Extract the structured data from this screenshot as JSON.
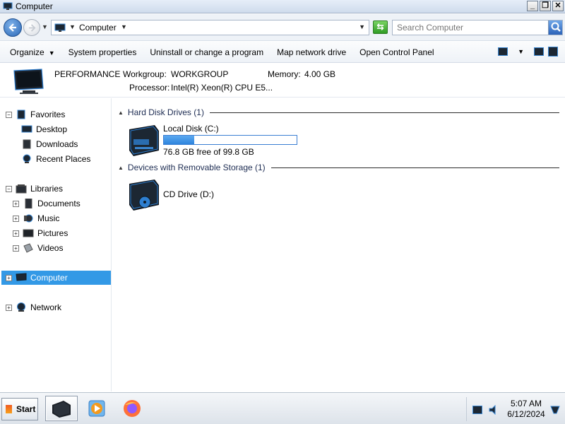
{
  "window": {
    "title": "Computer"
  },
  "window_buttons": {
    "minimize": "_",
    "maximize": "❐",
    "close": "✕"
  },
  "address": {
    "location": "Computer"
  },
  "search": {
    "placeholder": "Search Computer"
  },
  "commands": {
    "organize": "Organize",
    "system_properties": "System properties",
    "uninstall": "Uninstall or change a program",
    "map_drive": "Map network drive",
    "control_panel": "Open Control Panel"
  },
  "details": {
    "computer_name": "PERFORMANCE",
    "workgroup_label": "Workgroup:",
    "workgroup_value": "WORKGROUP",
    "memory_label": "Memory:",
    "memory_value": "4.00 GB",
    "processor_label": "Processor:",
    "processor_value": "Intel(R) Xeon(R) CPU E5..."
  },
  "nav": {
    "favorites": "Favorites",
    "desktop": "Desktop",
    "downloads": "Downloads",
    "recent_places": "Recent Places",
    "libraries": "Libraries",
    "documents": "Documents",
    "music": "Music",
    "pictures": "Pictures",
    "videos": "Videos",
    "computer": "Computer",
    "network": "Network",
    "expand_glyph": "+",
    "collapse_glyph": "−"
  },
  "groups": {
    "hdd": "Hard Disk Drives (1)",
    "removable": "Devices with Removable Storage (1)"
  },
  "drives": {
    "local": {
      "name": "Local Disk (C:)",
      "space": "76.8 GB free of 99.8 GB",
      "used_fraction": 0.23
    },
    "cd": {
      "name": "CD Drive (D:)"
    }
  },
  "taskbar": {
    "start": "Start",
    "time": "5:07 AM",
    "date": "6/12/2024"
  },
  "colors": {
    "accent": "#3399e6",
    "drive_bar": "#3a7ed3"
  }
}
